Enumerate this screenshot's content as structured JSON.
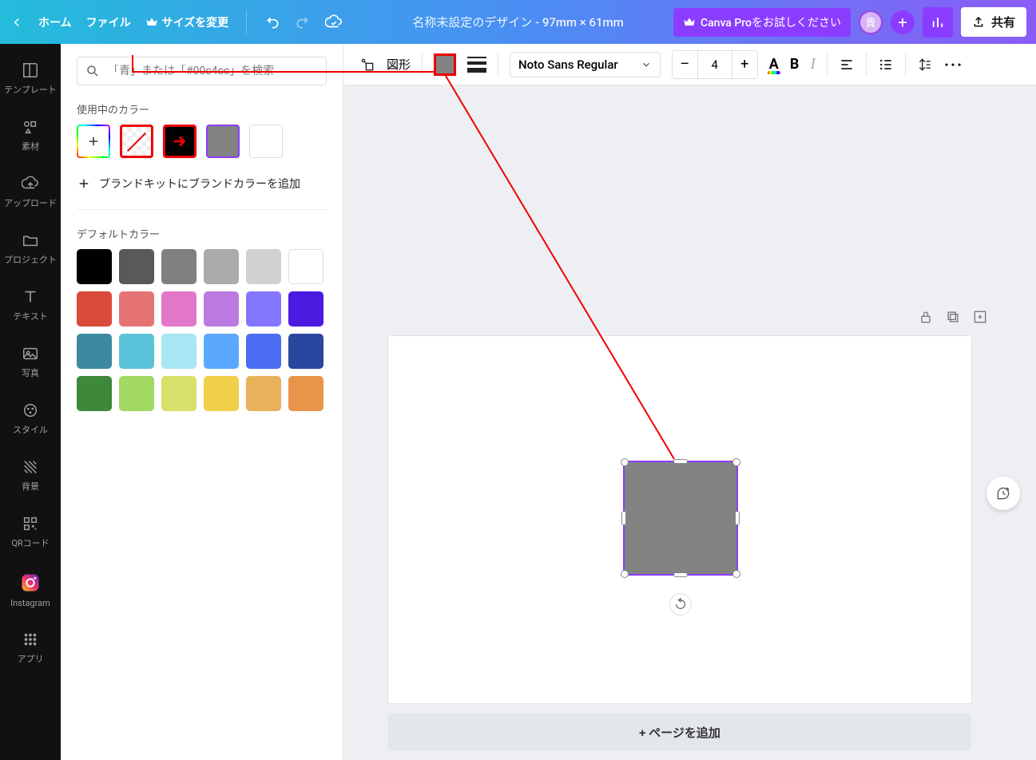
{
  "header": {
    "home": "ホーム",
    "file": "ファイル",
    "resize": "サイズを変更",
    "doc_title": "名称未設定のデザイン - 97mm × 61mm",
    "pro": "Canva Proをお試しください",
    "avatar": "貴",
    "share": "共有"
  },
  "sidebar": {
    "items": [
      "テンプレート",
      "素材",
      "アップロード",
      "プロジェクト",
      "テキスト",
      "写真",
      "スタイル",
      "背景",
      "QRコード",
      "Instagram",
      "アプリ"
    ]
  },
  "panel": {
    "search_placeholder": "「青」または「#00c4cc」を検索",
    "current_colors": "使用中のカラー",
    "add_brand": "ブランドキットにブランドカラーを追加",
    "default_colors": "デフォルトカラー",
    "colors": [
      "#000000",
      "#595959",
      "#808080",
      "#ababab",
      "#d1d1d1",
      "#ffffff",
      "#d84a3a",
      "#e57373",
      "#e277c9",
      "#ba7ae0",
      "#8576ff",
      "#4b1ae0",
      "#3c8aa1",
      "#5bc3d9",
      "#a7e6f2",
      "#5aa9ff",
      "#4a6cf0",
      "#27489e",
      "#3e8839",
      "#a1d961",
      "#d9e069",
      "#f0d04a",
      "#e8b25b",
      "#e8954a"
    ],
    "selected_color": "#838383"
  },
  "toolbar": {
    "shape_label": "図形",
    "font": "Noto Sans Regular",
    "font_size": "4",
    "minus": "–",
    "plus": "+",
    "text_color_label": "A",
    "bold_label": "B",
    "italic_label": "I"
  },
  "canvas": {
    "add_page": "+ ページを追加"
  }
}
